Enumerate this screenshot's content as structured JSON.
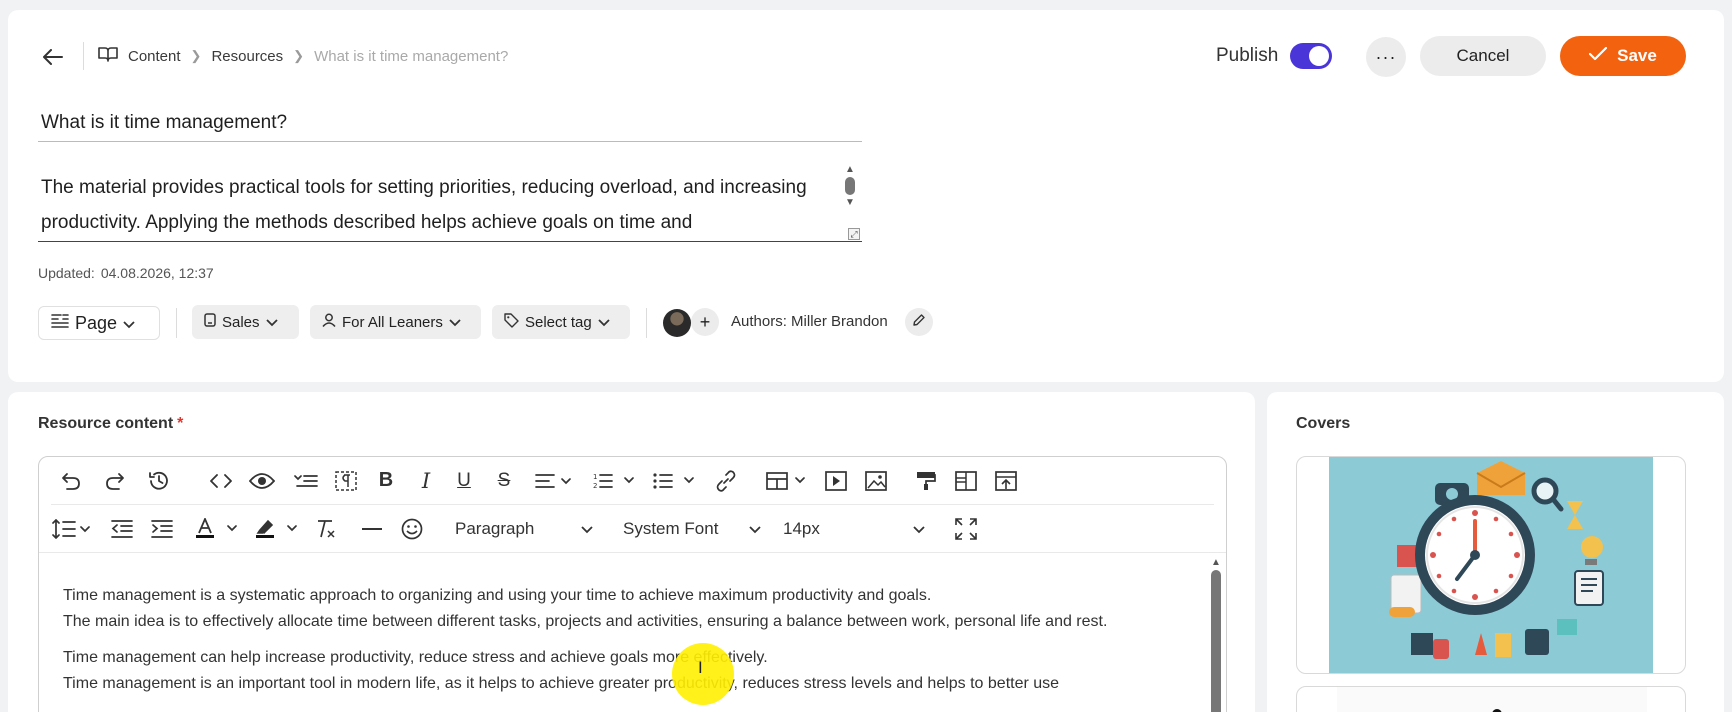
{
  "header": {
    "breadcrumb": [
      "Content",
      "Resources",
      "What is it time management?"
    ],
    "publish_label": "Publish",
    "publish_on": true,
    "more_label": "···",
    "cancel_label": "Cancel",
    "save_label": "Save",
    "save_color": "#f2620f",
    "toggle_color": "#4a35d8"
  },
  "resource": {
    "title": "What is it time management?",
    "description": "The material provides practical tools for setting priorities, reducing overload, and increasing productivity. Applying the methods described helps achieve goals on time and",
    "updated_label": "Updated:",
    "updated_value": "04.08.2026, 12:37"
  },
  "meta": {
    "page_label": "Page",
    "sales_label": "Sales",
    "audience_label": "For All Leaners",
    "tag_label": "Select tag",
    "authors_text": "Authors: Miller Brandon"
  },
  "content": {
    "section_label": "Resource content",
    "required_mark": "*",
    "block_format": "Paragraph",
    "font_family": "System Font",
    "font_size": "14px",
    "paragraphs": [
      "Time management is a systematic approach to organizing and using your time to achieve maximum productivity and goals.",
      "The main idea is to effectively allocate time between different tasks, projects and activities, ensuring a balance between work, personal life and rest.",
      "Time management can help increase productivity, reduce stress and achieve goals more effectively.",
      "Time management is an important tool in modern life, as it helps to achieve greater productivity, reduces stress levels and helps to better use"
    ]
  },
  "covers": {
    "section_label": "Covers"
  }
}
